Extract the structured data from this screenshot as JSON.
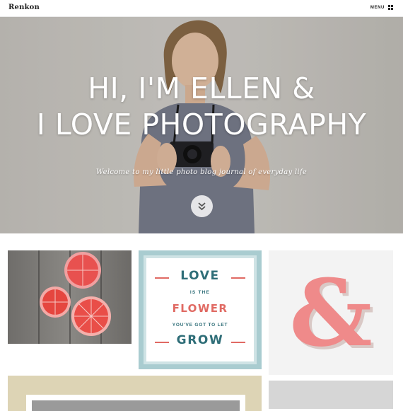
{
  "site": {
    "logo": "Renkon",
    "menu_label": "MENU"
  },
  "hero": {
    "title_line1": "HI, I'M ELLEN &",
    "title_line2": "I LOVE PHOTOGRAPHY",
    "subtitle": "Welcome to my little photo blog journal of everyday life",
    "scroll_icon": "double-chevron-down-icon"
  },
  "posts": {
    "poster": {
      "line1": "LOVE",
      "line2": "IS THE",
      "line3": "FLOWER",
      "line4": "YOU'VE GOT TO LET",
      "line5": "GROW"
    },
    "ampersand": "&"
  },
  "colors": {
    "poster_teal": "#2f6e78",
    "poster_coral": "#e06a63",
    "poster_frame": "#a9ccd0",
    "ampersand": "#ef8a8a"
  }
}
